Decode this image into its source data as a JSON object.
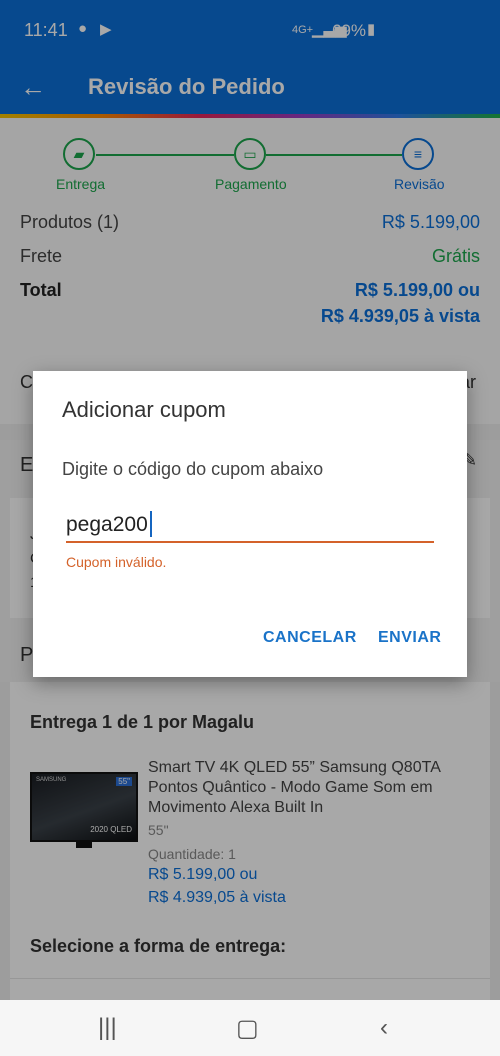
{
  "status_bar": {
    "time": "11:41",
    "network": "4G+",
    "battery": "69%"
  },
  "app_bar": {
    "title": "Revisão do Pedido"
  },
  "steps": [
    {
      "label": "Entrega",
      "icon": "truck-icon"
    },
    {
      "label": "Pagamento",
      "icon": "card-icon"
    },
    {
      "label": "Revisão",
      "icon": "list-icon"
    }
  ],
  "summary": {
    "products_label": "Produtos (1)",
    "products_value": "R$ 5.199,00",
    "shipping_label": "Frete",
    "shipping_value": "Grátis",
    "total_label": "Total",
    "total_value": "R$ 5.199,00 ou",
    "total_cash": "R$ 4.939,05 à vista"
  },
  "background_peek": {
    "coupon_row_left": "C",
    "coupon_row_right": "ar",
    "address_title": "E",
    "address_lines": [
      "J",
      "C",
      "1"
    ],
    "products_title": "P"
  },
  "delivery": {
    "title": "Entrega 1 de 1 por Magalu",
    "product_name": "Smart TV 4K QLED 55” Samsung Q80TA Pontos Quântico - Modo Game Som em Movimento Alexa Built In",
    "product_size": "55\"",
    "quantity": "Quantidade:  1",
    "price": "R$ 5.199,00 ou",
    "cash_price": "R$ 4.939,05 à vista",
    "select_label": "Selecione a forma de entrega:",
    "tv_brand": "SAMSUNG",
    "tv_inch": "55\"",
    "tv_badge": "2020 QLED"
  },
  "dialog": {
    "title": "Adicionar cupom",
    "message": "Digite o código do cupom abaixo",
    "input_value": "pega200",
    "error": "Cupom inválido.",
    "cancel_label": "CANCELAR",
    "send_label": "ENVIAR"
  },
  "colors": {
    "brand_blue": "#0c6fd8",
    "success_green": "#1ca64c",
    "error_orange": "#d4622a"
  }
}
